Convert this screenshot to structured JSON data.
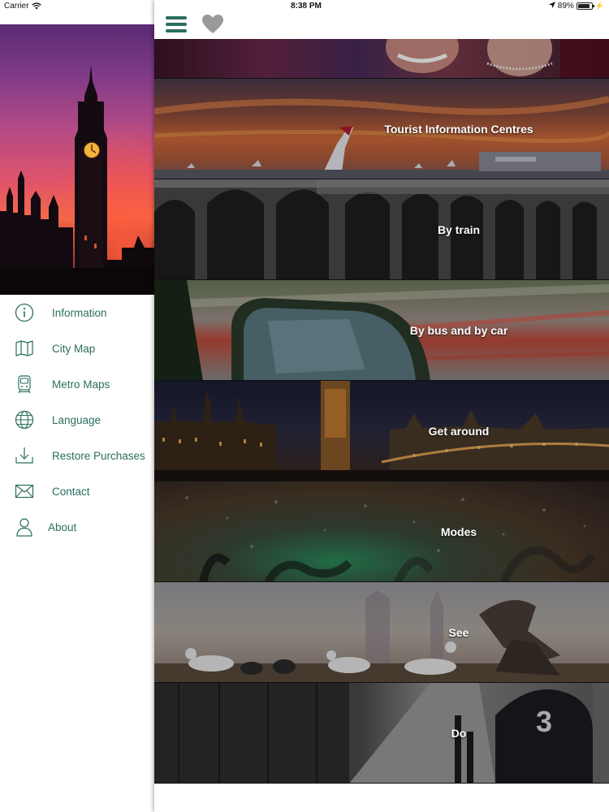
{
  "status_bar": {
    "carrier": "Carrier",
    "time": "8:38 PM",
    "battery": "89%",
    "battery_level": 0.89,
    "icons": [
      "wifi-icon",
      "location-arrow-icon",
      "battery-icon",
      "charging-icon"
    ]
  },
  "sidebar": {
    "items": [
      {
        "label": "Information",
        "icon": "info-circle-icon"
      },
      {
        "label": "City Map",
        "icon": "map-icon"
      },
      {
        "label": "Metro Maps",
        "icon": "train-icon"
      },
      {
        "label": "Language",
        "icon": "globe-icon"
      },
      {
        "label": "Restore Purchases",
        "icon": "download-icon"
      },
      {
        "label": "Contact",
        "icon": "envelope-icon"
      },
      {
        "label": "About",
        "icon": "person-icon"
      }
    ]
  },
  "toolbar": {
    "menu_icon": "hamburger-menu-icon",
    "favorite_icon": "heart-icon"
  },
  "tiles": [
    {
      "label": ""
    },
    {
      "label": "Tourist Information Centres"
    },
    {
      "label": "By train"
    },
    {
      "label": "By bus and by car"
    },
    {
      "label": "Get around"
    },
    {
      "label": "Modes"
    },
    {
      "label": "See"
    },
    {
      "label": "Do"
    }
  ],
  "colors": {
    "accent": "#2a6e5e",
    "heart": "#9a9a9a"
  }
}
